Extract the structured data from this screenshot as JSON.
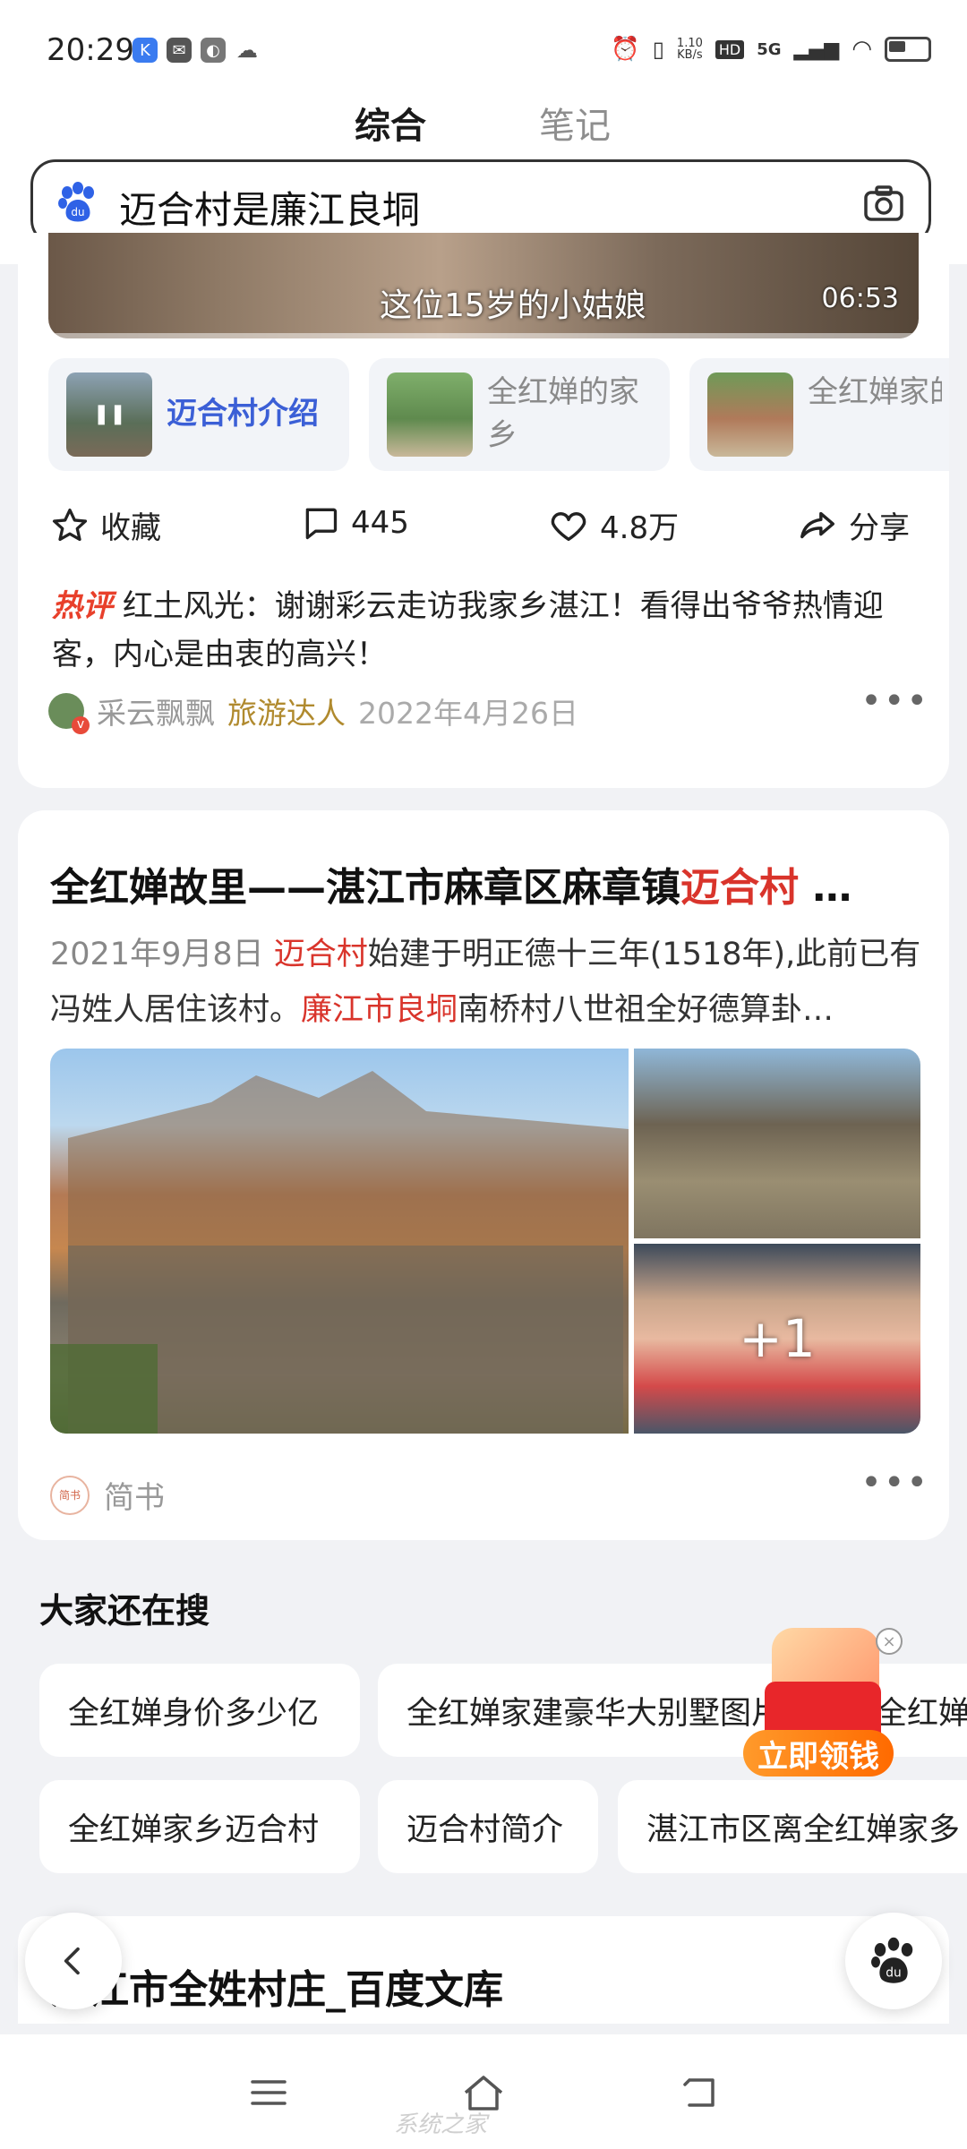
{
  "status_bar": {
    "time": "20:29",
    "net_speed": "1.10\nKB/s",
    "hd": "HD",
    "network": "5G"
  },
  "header": {
    "tabs": [
      {
        "label": "综合",
        "active": true
      },
      {
        "label": "笔记",
        "active": false
      }
    ],
    "search": {
      "query": "迈合村是廉江良垌"
    }
  },
  "video_card": {
    "caption": "这位15岁的小姑娘",
    "duration": "06:53",
    "chips": [
      {
        "label": "迈合村介绍",
        "active": true
      },
      {
        "label": "全红婵的家乡",
        "active": false
      },
      {
        "label": "全红婵家的环境",
        "active": false
      }
    ],
    "actions": {
      "favorite": "收藏",
      "comments": "445",
      "likes": "4.8万",
      "share": "分享"
    },
    "hot_comment": {
      "tag": "热评",
      "text": "红土风光：谢谢彩云走访我家乡湛江！看得出爷爷热情迎客，内心是由衷的高兴！"
    },
    "author": {
      "name": "采云飘飘",
      "badge": "旅游达人",
      "date": "2022年4月26日"
    }
  },
  "article_card": {
    "title_prefix": "全红婵故里——湛江市麻章区麻章镇",
    "title_highlight": "迈合村",
    "title_suffix": "…",
    "date": "2021年9月8日",
    "desc_hl1": "迈合村",
    "desc_part1": "始建于明正德十三年(1518年),此前已有冯姓人居住该村。",
    "desc_hl2": "廉江市良垌",
    "desc_part2": "南桥村八世祖全好德算卦…",
    "extra_images": "+1",
    "source": "简书",
    "source_icon_text": "简书"
  },
  "also_search": {
    "title": "大家还在搜",
    "row1": [
      "全红婵身价多少亿",
      "全红婵家建豪华大别墅图片",
      "全红婵"
    ],
    "row2": [
      "全红婵家乡迈合村",
      "迈合村简介",
      "湛江市区离全红婵家多"
    ]
  },
  "promo": {
    "button": "立即领钱"
  },
  "next_card": {
    "title": "湛江市全姓村庄_百度文库"
  },
  "watermark": "系统之家",
  "colors": {
    "accent_blue": "#3b5fd6",
    "highlight_red": "#d9342b",
    "hot_red": "#e8402b",
    "badge_gold": "#b08a2e"
  }
}
